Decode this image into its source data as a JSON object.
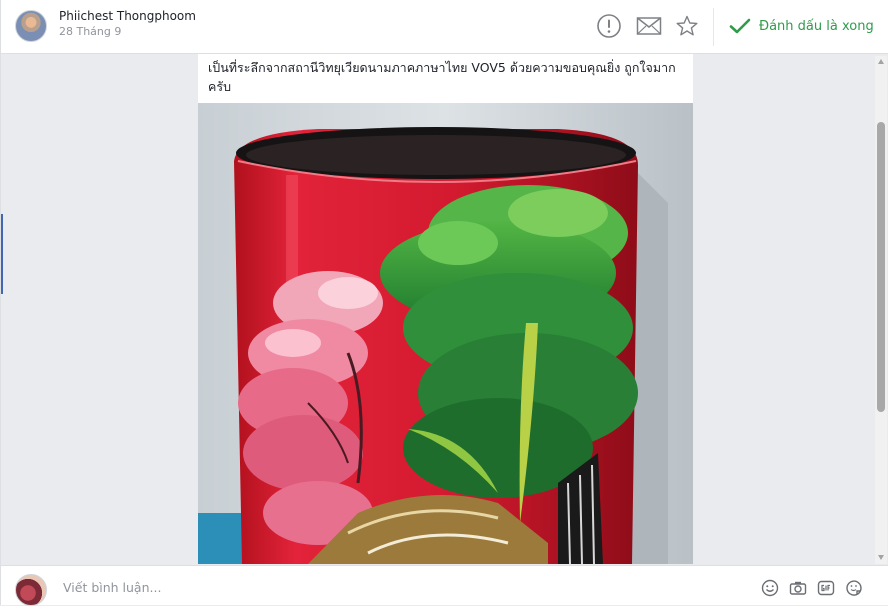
{
  "header": {
    "author_name": "Phiichest Thongphoom",
    "date": "28 Tháng 9",
    "mark_done_label": "Đánh dấu là xong"
  },
  "post": {
    "text": "เป็นที่ระลึกจากสถานีวิทยุเวียดนามภาคภาษาไทย VOV5 ด้วยความขอบคุณยิ่ง ถูกใจมากครับ"
  },
  "comment": {
    "placeholder": "Viết bình luận..."
  },
  "icons": {
    "report": "exclamation-circle-icon",
    "message": "envelope-icon",
    "favorite": "star-icon",
    "done": "checkmark-icon",
    "emoji": "smiley-icon",
    "photo": "camera-icon",
    "gif": "gif-icon",
    "sticker": "sticker-icon"
  },
  "colors": {
    "done_green": "#2e9c4a",
    "accent_blue": "#4267b2"
  }
}
